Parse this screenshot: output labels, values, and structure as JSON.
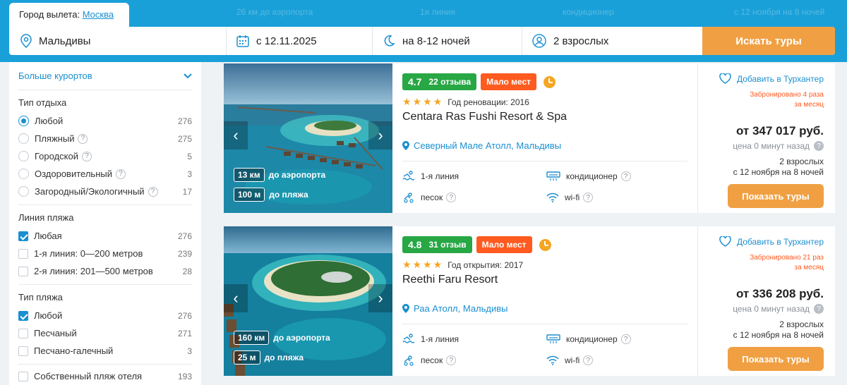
{
  "search": {
    "city_label": "Город вылета:",
    "city_value": "Москва",
    "destination": "Мальдивы",
    "date": "с 12.11.2025",
    "nights": "на 8-12 ночей",
    "guests": "2 взрослых",
    "button": "Искать туры"
  },
  "ghost": {
    "a": "26 км до аэропорта",
    "b": "1я линия",
    "c": "кондиционер",
    "d": "с 12 ноября на 8 ночей"
  },
  "sidebar": {
    "more_resorts": "Больше курортов",
    "rest_type": {
      "title": "Тип отдыха",
      "options": [
        {
          "label": "Любой",
          "count": "276"
        },
        {
          "label": "Пляжный",
          "count": "275"
        },
        {
          "label": "Городской",
          "count": "5"
        },
        {
          "label": "Оздоровительный",
          "count": "3"
        },
        {
          "label": "Загородный/Экологичный",
          "count": "17"
        }
      ]
    },
    "beach_line": {
      "title": "Линия пляжа",
      "options": [
        {
          "label": "Любая",
          "count": "276"
        },
        {
          "label": "1-я линия: 0—200 метров",
          "count": "239"
        },
        {
          "label": "2-я линия: 201—500 метров",
          "count": "28"
        }
      ]
    },
    "beach_type": {
      "title": "Тип пляжа",
      "options": [
        {
          "label": "Любой",
          "count": "276"
        },
        {
          "label": "Песчаный",
          "count": "271"
        },
        {
          "label": "Песчано-галечный",
          "count": "3"
        },
        {
          "label": "Собственный пляж отеля",
          "count": "193"
        }
      ]
    }
  },
  "hotels": [
    {
      "rating": "4.7",
      "reviews": "22 отзыва",
      "few_left": "Мало мест",
      "stars": "★★★★",
      "year_text": "Год реновации: 2016",
      "name": "Centara Ras Fushi Resort & Spa",
      "location": "Северный Мале Атолл, Мальдивы",
      "airport_km": "13 км",
      "airport_label": "до аэропорта",
      "beach_m": "100 м",
      "beach_label": "до пляжа",
      "amenities": [
        "1-я линия",
        "кондиционер",
        "песок",
        "wi-fi"
      ],
      "fav": "Добавить в Турхантер",
      "booked": "Забронировано 4 раза",
      "booked_period": "за месяц",
      "price": "от 347 017 руб.",
      "price_age": "цена 0 минут назад",
      "tour_guests": "2 взрослых",
      "tour_dates": "с 12 ноября на 8 ночей",
      "button": "Показать туры"
    },
    {
      "rating": "4.8",
      "reviews": "31 отзыв",
      "few_left": "Мало мест",
      "stars": "★★★★",
      "year_text": "Год открытия: 2017",
      "name": "Reethi Faru Resort",
      "location": "Раа Атолл, Мальдивы",
      "airport_km": "160 км",
      "airport_label": "до аэропорта",
      "beach_m": "25 м",
      "beach_label": "до пляжа",
      "amenities": [
        "1-я линия",
        "кондиционер",
        "песок",
        "wi-fi"
      ],
      "fav": "Добавить в Турхантер",
      "booked": "Забронировано 21 раз",
      "booked_period": "за месяц",
      "price": "от 336 208 руб.",
      "price_age": "цена 0 минут назад",
      "tour_guests": "2 взрослых",
      "tour_dates": "с 12 ноября на 8 ночей",
      "button": "Показать туры"
    }
  ],
  "colors": {
    "brand_blue": "#1aa0d8",
    "link": "#1a8fd1",
    "orange_button": "#f0a043",
    "rating_green": "#28a745",
    "alert_orange": "#ff5a1f"
  }
}
